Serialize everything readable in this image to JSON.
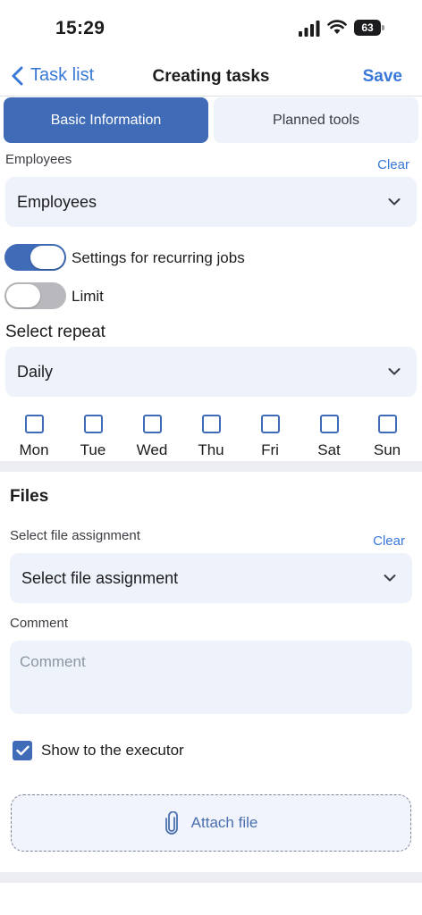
{
  "status_bar": {
    "time": "15:29",
    "battery": "63"
  },
  "nav": {
    "back_label": "Task list",
    "title": "Creating tasks",
    "save_label": "Save"
  },
  "tabs": [
    {
      "label": "Basic Information",
      "active": true
    },
    {
      "label": "Planned tools",
      "active": false
    }
  ],
  "employees": {
    "label": "Employees",
    "clear_label": "Clear",
    "value": "Employees"
  },
  "toggles": [
    {
      "label": "Settings for recurring jobs",
      "on": true
    },
    {
      "label": "Limit",
      "on": false
    }
  ],
  "repeat": {
    "label": "Select repeat",
    "value": "Daily"
  },
  "days": [
    "Mon",
    "Tue",
    "Wed",
    "Thu",
    "Fri",
    "Sat",
    "Sun"
  ],
  "files": {
    "title": "Files",
    "assignment_label": "Select file assignment",
    "clear_label": "Clear",
    "assignment_value": "Select file assignment",
    "comment_label": "Comment",
    "comment_placeholder": "Comment",
    "show_executor_label": "Show to the executor",
    "show_executor_checked": true,
    "attach_label": "Attach file"
  },
  "colors": {
    "accent": "#3f6bb7",
    "link": "#3a78d8",
    "field_bg": "#eef2fb"
  }
}
